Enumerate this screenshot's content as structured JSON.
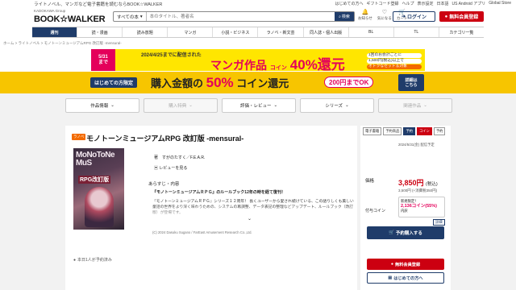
{
  "topbar": {
    "tagline": "ライトノベル、マンガなど電子書籍を読むならBOOK☆WALKER",
    "links": [
      "はじめての方へ",
      "ギフトコード登録",
      "ヘルプ",
      "表示設定",
      "日本語",
      "US Android アプリ",
      "Global Store"
    ]
  },
  "header": {
    "group": "KADOKAWA Group",
    "logo": "BOOK☆WALKER",
    "search_scope": "すべての本",
    "search_placeholder": "本のタイトル、著者名",
    "search_button": "検索",
    "icons": [
      {
        "name": "notice",
        "label": "お知らせ",
        "glyph": "🔔"
      },
      {
        "name": "wishlist",
        "label": "気になる",
        "glyph": "♡"
      },
      {
        "name": "cart",
        "label": "カート",
        "glyph": "🛒"
      }
    ],
    "login": "ログイン",
    "register": "無料会員登録"
  },
  "nav": [
    "週刊",
    "読・漫画",
    "読み放題",
    "マンガ",
    "小説・ビジネス",
    "ラノベ・新文芸",
    "同人誌・個人出版",
    "BL",
    "TL",
    "カテゴリ一覧"
  ],
  "breadcrumb": "ホーム > ライトノベル > モノトーンミュージアムRPG 改訂版 -mensural-",
  "banner1": {
    "date": "5/31",
    "date_suffix": "まで",
    "sub": "2024/4/25までに配信された",
    "main": "マンガ作品",
    "coin": "コイン",
    "percent": "40%還元",
    "right1": "1回のお会計ごとに",
    "right2": "1,500円(税込)以上で",
    "right3": "オトクなセット＆対象"
  },
  "banner2": {
    "tag": "はじめての方限定",
    "main": "購入金額の",
    "percent": "50%",
    "main2": "コイン還元",
    "pill": "200円までOK",
    "button_l1": "詳細は",
    "button_l2": "こちら"
  },
  "filters": [
    {
      "label": "作品情報",
      "disabled": false
    },
    {
      "label": "購入特典",
      "disabled": true
    },
    {
      "label": "評価・レビュー",
      "disabled": false
    },
    {
      "label": "シリーズ",
      "disabled": false
    },
    {
      "label": "関連作品",
      "disabled": true
    }
  ],
  "book": {
    "badge": "ラノベ",
    "title": "モノトーンミュージアムRPG 改訂版 -mensural-",
    "cover_title": "MoNoToNe MuS",
    "cover_sub": "RPG改訂版",
    "author_label": "著",
    "author": "すがのたすく／F.E.A.R.",
    "review_link": "レビューを見る",
    "synopsis_head": "あらすじ・内容",
    "synopsis_lead": "『モノトーンミュージアムＲＰＧ』のルールブック12年の時を経て復刊！",
    "synopsis_body": "『モノトーンミュージアムＲＰＧ』シリーズ１２周年！ 長くユーザーから愛され続けている、この語りしくも美しい童話の世界をより深く味わうための、システムの再調整、データ表記の整理などアップデート、ルールブック（改訂版）が登場です。",
    "copyright": "(C) 2024 Dasuku Sugano / FarEast Amusement Research Co.,Ltd.",
    "reading_note": "本日1人が予約済み"
  },
  "panel": {
    "tags": [
      {
        "label": "電子書籍",
        "style": "normal"
      },
      {
        "label": "予約商品",
        "style": "normal"
      },
      {
        "label": "予約",
        "style": "hl"
      },
      {
        "label": "コイン",
        "style": "red"
      },
      {
        "label": "予約",
        "style": "normal"
      }
    ],
    "release": "2024/5/31(金) 配信予定",
    "price_label": "価格",
    "price": "3,850円",
    "price_tax": "(税込)",
    "price_sub": "3,500円 (+消費税350円)",
    "coin_label": "付与コイン",
    "coin_title": "新規限定！",
    "coin_amount": "2,136コイン(55%)",
    "coin_note": "内訳",
    "coin_help": "詳細",
    "preorder": "予約購入する",
    "register2": "無料会員登録",
    "guide": "はじめての方へ"
  }
}
